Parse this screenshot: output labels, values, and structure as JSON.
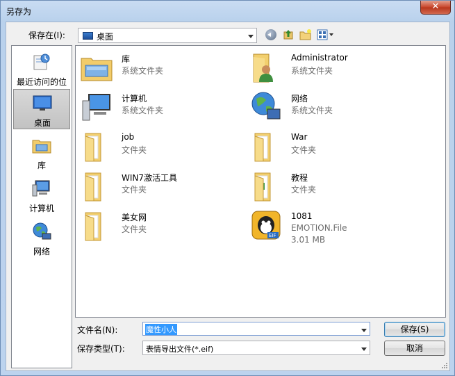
{
  "window": {
    "title": "另存为",
    "close_label": "✕"
  },
  "save_in": {
    "label": "保存在(I):",
    "value": "桌面"
  },
  "places": [
    {
      "label": "最近访问的位置",
      "icon": "recent-places-icon"
    },
    {
      "label": "桌面",
      "icon": "desktop-icon",
      "selected": true
    },
    {
      "label": "库",
      "icon": "library-icon"
    },
    {
      "label": "计算机",
      "icon": "computer-icon"
    },
    {
      "label": "网络",
      "icon": "network-icon"
    }
  ],
  "items": [
    {
      "name": "库",
      "sub1": "系统文件夹",
      "icon": "library-icon"
    },
    {
      "name": "Administrator",
      "sub1": "系统文件夹",
      "icon": "user-folder-icon"
    },
    {
      "name": "计算机",
      "sub1": "系统文件夹",
      "icon": "computer-icon"
    },
    {
      "name": "网络",
      "sub1": "系统文件夹",
      "icon": "network-icon"
    },
    {
      "name": "job",
      "sub1": "文件夹",
      "icon": "folder-icon"
    },
    {
      "name": "War",
      "sub1": "文件夹",
      "icon": "folder-icon"
    },
    {
      "name": "WIN7激活工具",
      "sub1": "文件夹",
      "icon": "folder-icon"
    },
    {
      "name": "教程",
      "sub1": "文件夹",
      "icon": "folder-icon"
    },
    {
      "name": "美女网",
      "sub1": "文件夹",
      "icon": "folder-icon"
    },
    {
      "name": "1081",
      "sub1": "EMOTION.File",
      "sub2": "3.01 MB",
      "icon": "qq-emotion-file-icon"
    }
  ],
  "file_name": {
    "label": "文件名(N):",
    "value": "魔性小人"
  },
  "file_type": {
    "label": "保存类型(T):",
    "value": "表情导出文件(*.eif)"
  },
  "buttons": {
    "save": "保存(S)",
    "cancel": "取消"
  }
}
